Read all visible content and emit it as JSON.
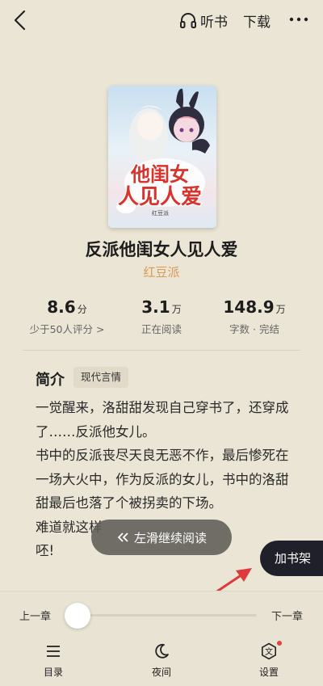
{
  "topbar": {
    "listen_label": "听书",
    "download_label": "下载"
  },
  "book": {
    "title": "反派他闺女人见人爱",
    "author": "红豆派",
    "cover_title_text": "他闺女人见人爱",
    "cover_author_text": "红豆派"
  },
  "stats": [
    {
      "value": "8.6",
      "unit": "分",
      "sub": "少于50人评分 >"
    },
    {
      "value": "3.1",
      "unit": "万",
      "sub": "正在阅读"
    },
    {
      "value": "148.9",
      "unit": "万",
      "sub": "字数 · 完结"
    }
  ],
  "intro": {
    "heading": "简介",
    "tag": "现代言情",
    "paragraphs": [
      "一觉醒来，洛甜甜发现自己穿书了，还穿成了……反派他女儿。",
      "书中的反派丧尽天良无恶不作，最后惨死在一场大火中，作为反派的女儿，书中的洛甜甜最后也落了个被拐卖的下场。",
      "难道就这样",
      "呸!"
    ]
  },
  "toast": {
    "label": "左滑继续阅读"
  },
  "shelf_button": {
    "label": "加书架"
  },
  "chapter_nav": {
    "prev": "上一章",
    "next": "下一章",
    "progress": 0
  },
  "bottom_nav": [
    {
      "label": "目录",
      "icon": "menu-icon"
    },
    {
      "label": "夜间",
      "icon": "moon-icon"
    },
    {
      "label": "设置",
      "icon": "settings-icon"
    }
  ],
  "colors": {
    "background": "#ebe5d5",
    "author": "#d99a52",
    "arrow": "#e0393b",
    "shelf": "#20202a"
  }
}
